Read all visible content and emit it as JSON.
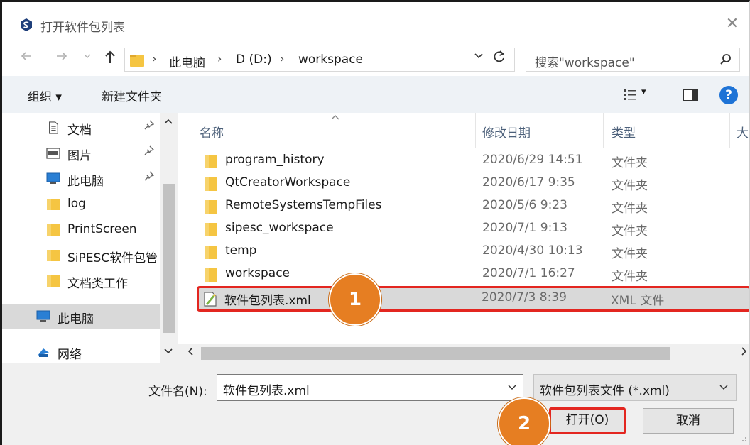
{
  "window": {
    "title": "打开软件包列表",
    "close_glyph": "✕"
  },
  "address": {
    "breadcrumbs": [
      "此电脑",
      "D (D:)",
      "workspace"
    ],
    "separator": "›",
    "search_placeholder": "搜索\"workspace\""
  },
  "toolbar": {
    "organize": "组织 ▾",
    "new_folder": "新建文件夹",
    "view_dropdown": "▾",
    "help": "?"
  },
  "nav": {
    "items": [
      {
        "label": "文档",
        "icon": "document-icon",
        "pinned": true
      },
      {
        "label": "图片",
        "icon": "pictures-icon",
        "pinned": true
      },
      {
        "label": "此电脑",
        "icon": "computer-icon",
        "pinned": true
      },
      {
        "label": "log",
        "icon": "folder-icon",
        "pinned": false
      },
      {
        "label": "PrintScreen",
        "icon": "folder-icon",
        "pinned": false
      },
      {
        "label": "SiPESC软件包管",
        "icon": "folder-icon",
        "pinned": false
      },
      {
        "label": "文档类工作",
        "icon": "folder-icon",
        "pinned": false
      },
      {
        "label": "此电脑",
        "icon": "computer-icon",
        "pinned": false,
        "selected": true
      },
      {
        "label": "网络",
        "icon": "network-icon",
        "pinned": false
      }
    ],
    "pin_glyph": "📌"
  },
  "columns": {
    "name": "名称",
    "date": "修改日期",
    "type": "类型",
    "size": "大"
  },
  "files": [
    {
      "name": "program_history",
      "date": "2020/6/29 14:51",
      "type": "文件夹",
      "icon": "folder-icon"
    },
    {
      "name": "QtCreatorWorkspace",
      "date": "2020/6/17 9:35",
      "type": "文件夹",
      "icon": "folder-icon"
    },
    {
      "name": "RemoteSystemsTempFiles",
      "date": "2020/5/6 9:23",
      "type": "文件夹",
      "icon": "folder-icon"
    },
    {
      "name": "sipesc_workspace",
      "date": "2020/7/1 9:13",
      "type": "文件夹",
      "icon": "folder-icon"
    },
    {
      "name": "temp",
      "date": "2020/4/30 10:13",
      "type": "文件夹",
      "icon": "folder-icon"
    },
    {
      "name": "workspace",
      "date": "2020/7/1 16:27",
      "type": "文件夹",
      "icon": "folder-icon"
    },
    {
      "name": "软件包列表.xml",
      "date": "2020/7/3 8:39",
      "type": "XML 文件",
      "icon": "xml-file-icon",
      "selected": true
    }
  ],
  "bottom": {
    "filename_label": "文件名(N):",
    "filename_value": "软件包列表.xml",
    "filter_value": "软件包列表文件 (*.xml)",
    "open_button": "打开(O)",
    "cancel_button": "取消"
  },
  "callouts": [
    "1",
    "2"
  ],
  "colors": {
    "highlight_border": "#e32620",
    "callout": "#e67e22",
    "folder": "#f5c542",
    "help": "#1e73d6"
  }
}
